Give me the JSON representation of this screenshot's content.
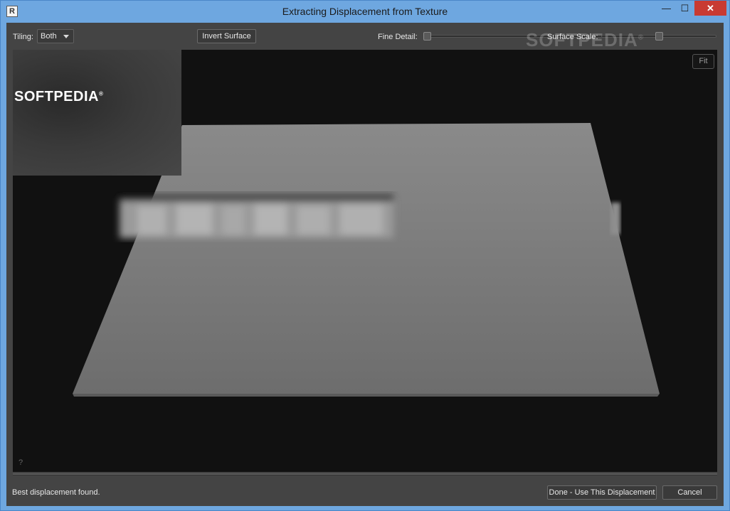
{
  "window": {
    "title": "Extracting Displacement from Texture",
    "app_icon_letter": "R",
    "minimize_glyph": "—",
    "maximize_glyph": "☐",
    "close_glyph": "✕"
  },
  "toolbar": {
    "tiling_label": "Tiling:",
    "tiling_value": "Both",
    "invert_label": "Invert Surface",
    "fine_detail_label": "Fine Detail:",
    "fine_detail_value": 0.0,
    "surface_scale_label": "Surface Scale:",
    "surface_scale_value": 0.5
  },
  "viewport": {
    "thumbnail_text": "SOFTPEDIA",
    "thumbnail_mark": "®",
    "fit_label": "Fit",
    "help_label": "?"
  },
  "watermark": {
    "text": "SOFTPEDIA",
    "mark": "®"
  },
  "status": {
    "message": "Best displacement found.",
    "done_label": "Done - Use This Displacement",
    "cancel_label": "Cancel"
  },
  "colors": {
    "title_bar": "#6ea7e0",
    "close_button": "#c83a32",
    "panel": "#444444",
    "viewport": "#111111"
  }
}
